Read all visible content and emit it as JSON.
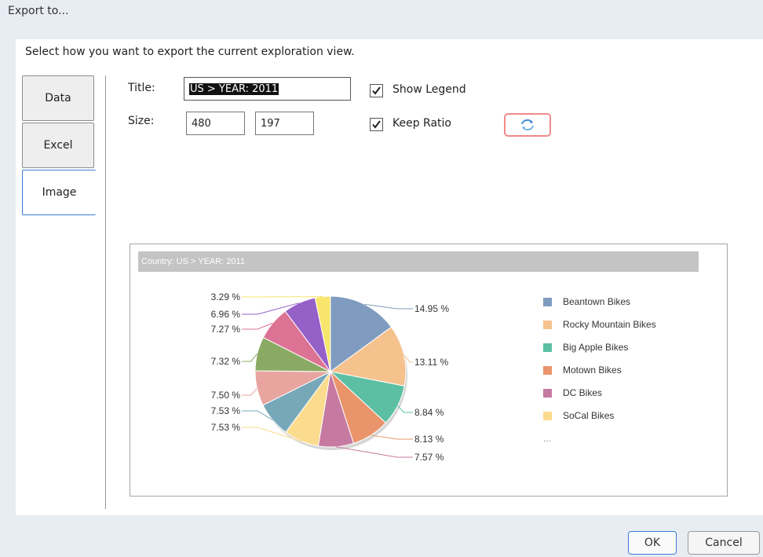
{
  "dialog": {
    "title": "Export to...",
    "instruction": "Select how you want to export the current exploration view."
  },
  "tabs": [
    {
      "label": "Data"
    },
    {
      "label": "Excel"
    },
    {
      "label": "Image"
    }
  ],
  "form": {
    "title_label": "Title:",
    "title_value": "US > YEAR: 2011",
    "size_label": "Size:",
    "width_value": "480",
    "height_value": "197",
    "show_legend_label": "Show Legend",
    "show_legend_checked": true,
    "keep_ratio_label": "Keep Ratio",
    "keep_ratio_checked": true,
    "refresh_icon": "refresh-icon"
  },
  "preview": {
    "header": "Country: US > YEAR: 2011",
    "legend_more": "..."
  },
  "chart_data": {
    "type": "pie",
    "title": "Country: US > YEAR: 2011",
    "slices": [
      {
        "name": "Beantown Bikes",
        "value": 14.95,
        "label": "14.95 %",
        "color": "#7f9cc0"
      },
      {
        "name": "Rocky Mountain Bikes",
        "value": 13.11,
        "label": "13.11 %",
        "color": "#f5c28e"
      },
      {
        "name": "Big Apple Bikes",
        "value": 8.84,
        "label": "8.84 %",
        "color": "#5cbfa4"
      },
      {
        "name": "Motown Bikes",
        "value": 8.13,
        "label": "8.13 %",
        "color": "#e9946b"
      },
      {
        "name": "DC Bikes",
        "value": 7.57,
        "label": "7.57 %",
        "color": "#c77aa1"
      },
      {
        "name": "SoCal Bikes",
        "value": 7.53,
        "label": "7.53 %",
        "color": "#fbdc8e"
      },
      {
        "name": "",
        "value": 7.53,
        "label": "7.53 %",
        "color": "#76a8ba"
      },
      {
        "name": "",
        "value": 7.5,
        "label": "7.50 %",
        "color": "#e8a59f"
      },
      {
        "name": "",
        "value": 7.32,
        "label": "7.32 %",
        "color": "#8aaa63"
      },
      {
        "name": "",
        "value": 7.27,
        "label": "7.27 %",
        "color": "#dc7394"
      },
      {
        "name": "",
        "value": 6.96,
        "label": "6.96 %",
        "color": "#9560c8"
      },
      {
        "name": "",
        "value": 3.29,
        "label": "3.29 %",
        "color": "#f8e66c"
      }
    ],
    "legend_position": "right"
  },
  "buttons": {
    "ok": "OK",
    "cancel": "Cancel"
  }
}
